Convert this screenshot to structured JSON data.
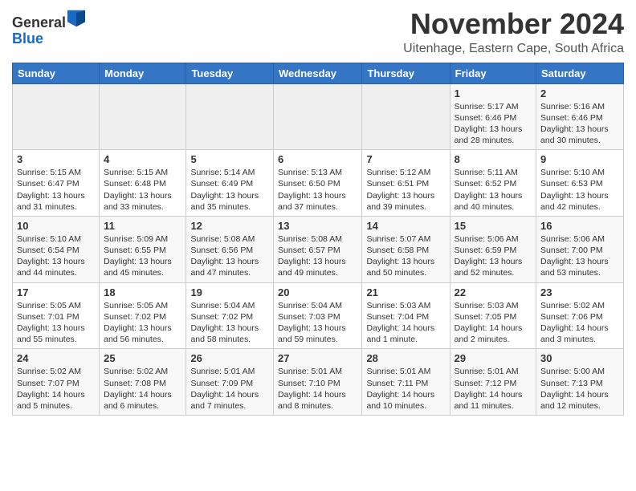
{
  "app": {
    "logo_general": "General",
    "logo_blue": "Blue",
    "month_title": "November 2024",
    "location": "Uitenhage, Eastern Cape, South Africa"
  },
  "calendar": {
    "headers": [
      "Sunday",
      "Monday",
      "Tuesday",
      "Wednesday",
      "Thursday",
      "Friday",
      "Saturday"
    ],
    "rows": [
      [
        {
          "day": "",
          "empty": true
        },
        {
          "day": "",
          "empty": true
        },
        {
          "day": "",
          "empty": true
        },
        {
          "day": "",
          "empty": true
        },
        {
          "day": "",
          "empty": true
        },
        {
          "day": "1",
          "lines": [
            "Sunrise: 5:17 AM",
            "Sunset: 6:46 PM",
            "Daylight: 13 hours",
            "and 28 minutes."
          ]
        },
        {
          "day": "2",
          "lines": [
            "Sunrise: 5:16 AM",
            "Sunset: 6:46 PM",
            "Daylight: 13 hours",
            "and 30 minutes."
          ]
        }
      ],
      [
        {
          "day": "3",
          "lines": [
            "Sunrise: 5:15 AM",
            "Sunset: 6:47 PM",
            "Daylight: 13 hours",
            "and 31 minutes."
          ]
        },
        {
          "day": "4",
          "lines": [
            "Sunrise: 5:15 AM",
            "Sunset: 6:48 PM",
            "Daylight: 13 hours",
            "and 33 minutes."
          ]
        },
        {
          "day": "5",
          "lines": [
            "Sunrise: 5:14 AM",
            "Sunset: 6:49 PM",
            "Daylight: 13 hours",
            "and 35 minutes."
          ]
        },
        {
          "day": "6",
          "lines": [
            "Sunrise: 5:13 AM",
            "Sunset: 6:50 PM",
            "Daylight: 13 hours",
            "and 37 minutes."
          ]
        },
        {
          "day": "7",
          "lines": [
            "Sunrise: 5:12 AM",
            "Sunset: 6:51 PM",
            "Daylight: 13 hours",
            "and 39 minutes."
          ]
        },
        {
          "day": "8",
          "lines": [
            "Sunrise: 5:11 AM",
            "Sunset: 6:52 PM",
            "Daylight: 13 hours",
            "and 40 minutes."
          ]
        },
        {
          "day": "9",
          "lines": [
            "Sunrise: 5:10 AM",
            "Sunset: 6:53 PM",
            "Daylight: 13 hours",
            "and 42 minutes."
          ]
        }
      ],
      [
        {
          "day": "10",
          "lines": [
            "Sunrise: 5:10 AM",
            "Sunset: 6:54 PM",
            "Daylight: 13 hours",
            "and 44 minutes."
          ]
        },
        {
          "day": "11",
          "lines": [
            "Sunrise: 5:09 AM",
            "Sunset: 6:55 PM",
            "Daylight: 13 hours",
            "and 45 minutes."
          ]
        },
        {
          "day": "12",
          "lines": [
            "Sunrise: 5:08 AM",
            "Sunset: 6:56 PM",
            "Daylight: 13 hours",
            "and 47 minutes."
          ]
        },
        {
          "day": "13",
          "lines": [
            "Sunrise: 5:08 AM",
            "Sunset: 6:57 PM",
            "Daylight: 13 hours",
            "and 49 minutes."
          ]
        },
        {
          "day": "14",
          "lines": [
            "Sunrise: 5:07 AM",
            "Sunset: 6:58 PM",
            "Daylight: 13 hours",
            "and 50 minutes."
          ]
        },
        {
          "day": "15",
          "lines": [
            "Sunrise: 5:06 AM",
            "Sunset: 6:59 PM",
            "Daylight: 13 hours",
            "and 52 minutes."
          ]
        },
        {
          "day": "16",
          "lines": [
            "Sunrise: 5:06 AM",
            "Sunset: 7:00 PM",
            "Daylight: 13 hours",
            "and 53 minutes."
          ]
        }
      ],
      [
        {
          "day": "17",
          "lines": [
            "Sunrise: 5:05 AM",
            "Sunset: 7:01 PM",
            "Daylight: 13 hours",
            "and 55 minutes."
          ]
        },
        {
          "day": "18",
          "lines": [
            "Sunrise: 5:05 AM",
            "Sunset: 7:02 PM",
            "Daylight: 13 hours",
            "and 56 minutes."
          ]
        },
        {
          "day": "19",
          "lines": [
            "Sunrise: 5:04 AM",
            "Sunset: 7:02 PM",
            "Daylight: 13 hours",
            "and 58 minutes."
          ]
        },
        {
          "day": "20",
          "lines": [
            "Sunrise: 5:04 AM",
            "Sunset: 7:03 PM",
            "Daylight: 13 hours",
            "and 59 minutes."
          ]
        },
        {
          "day": "21",
          "lines": [
            "Sunrise: 5:03 AM",
            "Sunset: 7:04 PM",
            "Daylight: 14 hours",
            "and 1 minute."
          ]
        },
        {
          "day": "22",
          "lines": [
            "Sunrise: 5:03 AM",
            "Sunset: 7:05 PM",
            "Daylight: 14 hours",
            "and 2 minutes."
          ]
        },
        {
          "day": "23",
          "lines": [
            "Sunrise: 5:02 AM",
            "Sunset: 7:06 PM",
            "Daylight: 14 hours",
            "and 3 minutes."
          ]
        }
      ],
      [
        {
          "day": "24",
          "lines": [
            "Sunrise: 5:02 AM",
            "Sunset: 7:07 PM",
            "Daylight: 14 hours",
            "and 5 minutes."
          ]
        },
        {
          "day": "25",
          "lines": [
            "Sunrise: 5:02 AM",
            "Sunset: 7:08 PM",
            "Daylight: 14 hours",
            "and 6 minutes."
          ]
        },
        {
          "day": "26",
          "lines": [
            "Sunrise: 5:01 AM",
            "Sunset: 7:09 PM",
            "Daylight: 14 hours",
            "and 7 minutes."
          ]
        },
        {
          "day": "27",
          "lines": [
            "Sunrise: 5:01 AM",
            "Sunset: 7:10 PM",
            "Daylight: 14 hours",
            "and 8 minutes."
          ]
        },
        {
          "day": "28",
          "lines": [
            "Sunrise: 5:01 AM",
            "Sunset: 7:11 PM",
            "Daylight: 14 hours",
            "and 10 minutes."
          ]
        },
        {
          "day": "29",
          "lines": [
            "Sunrise: 5:01 AM",
            "Sunset: 7:12 PM",
            "Daylight: 14 hours",
            "and 11 minutes."
          ]
        },
        {
          "day": "30",
          "lines": [
            "Sunrise: 5:00 AM",
            "Sunset: 7:13 PM",
            "Daylight: 14 hours",
            "and 12 minutes."
          ]
        }
      ]
    ]
  }
}
